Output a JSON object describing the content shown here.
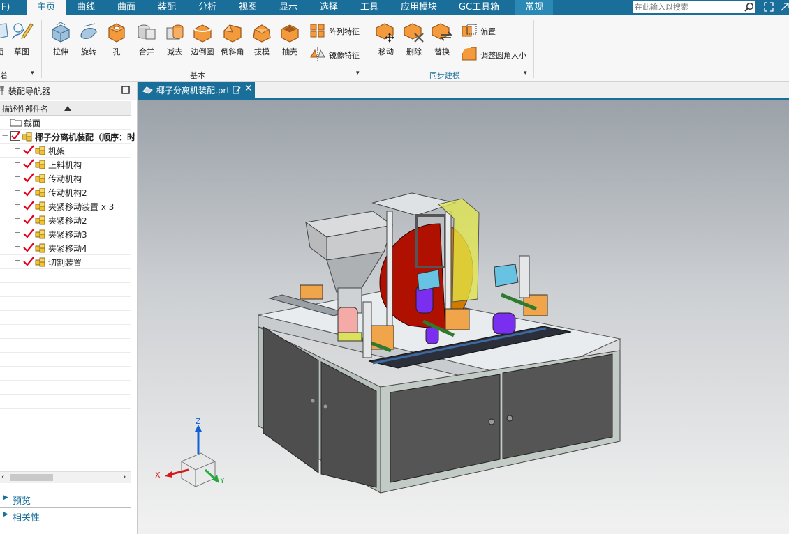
{
  "menu": {
    "items": [
      {
        "label": "F)"
      },
      {
        "label": "主页"
      },
      {
        "label": "曲线"
      },
      {
        "label": "曲面"
      },
      {
        "label": "装配"
      },
      {
        "label": "分析"
      },
      {
        "label": "视图"
      },
      {
        "label": "显示"
      },
      {
        "label": "选择"
      },
      {
        "label": "工具"
      },
      {
        "label": "应用模块"
      },
      {
        "label": "GC工具箱"
      },
      {
        "label": "常规"
      }
    ],
    "active_item": "主页",
    "search_placeholder": "在此输入以搜索"
  },
  "ribbon": {
    "left_partial_labels": [
      "面",
      "草图"
    ],
    "left_group_label": "着",
    "basic_buttons": [
      {
        "label": "拉伸",
        "icon": "extrude-icon"
      },
      {
        "label": "旋转",
        "icon": "revolve-icon"
      },
      {
        "label": "孔",
        "icon": "hole-icon"
      },
      {
        "label": "合并",
        "icon": "unite-icon"
      },
      {
        "label": "减去",
        "icon": "subtract-icon"
      },
      {
        "label": "边倒圆",
        "icon": "edge-blend-icon"
      },
      {
        "label": "倒斜角",
        "icon": "chamfer-icon"
      },
      {
        "label": "拔模",
        "icon": "draft-icon"
      },
      {
        "label": "抽壳",
        "icon": "shell-icon"
      }
    ],
    "basic_small_buttons": [
      {
        "label": "阵列特征",
        "icon": "pattern-feature-icon"
      },
      {
        "label": "镜像特征",
        "icon": "mirror-feature-icon"
      }
    ],
    "basic_group_label": "基本",
    "sync_buttons": [
      {
        "label": "移动",
        "icon": "move-face-icon"
      },
      {
        "label": "删除",
        "icon": "delete-face-icon"
      },
      {
        "label": "替换",
        "icon": "replace-face-icon"
      }
    ],
    "sync_small_buttons": [
      {
        "label": "偏置",
        "icon": "offset-face-icon"
      },
      {
        "label": "调整圆角大小",
        "icon": "resize-blend-icon"
      }
    ],
    "sync_group_label": "同步建模"
  },
  "navigator": {
    "title": "装配导航器",
    "column_header": "描述性部件名",
    "section_label": "截面",
    "root_label": "椰子分离机装配（顺序：时",
    "children": [
      {
        "label": "机架"
      },
      {
        "label": "上料机构"
      },
      {
        "label": "传动机构"
      },
      {
        "label": "传动机构2"
      },
      {
        "label": "夹紧移动装置 x 3"
      },
      {
        "label": "夹紧移动2"
      },
      {
        "label": "夹紧移动3"
      },
      {
        "label": "夹紧移动4"
      },
      {
        "label": "切割装置"
      }
    ],
    "panels": [
      {
        "label": "预览"
      },
      {
        "label": "相关性"
      }
    ]
  },
  "document": {
    "tab_label": "椰子分离机装配.prt"
  },
  "axes": {
    "z": "Z",
    "x": "X",
    "y": "Y"
  },
  "colors": {
    "accent": "#1a6f9a",
    "check": "#e2001a",
    "cabinet": "#4e4e4e",
    "blade": "#b01000",
    "hopper": "#c9cbcd",
    "bracket": "#e3e84a"
  }
}
